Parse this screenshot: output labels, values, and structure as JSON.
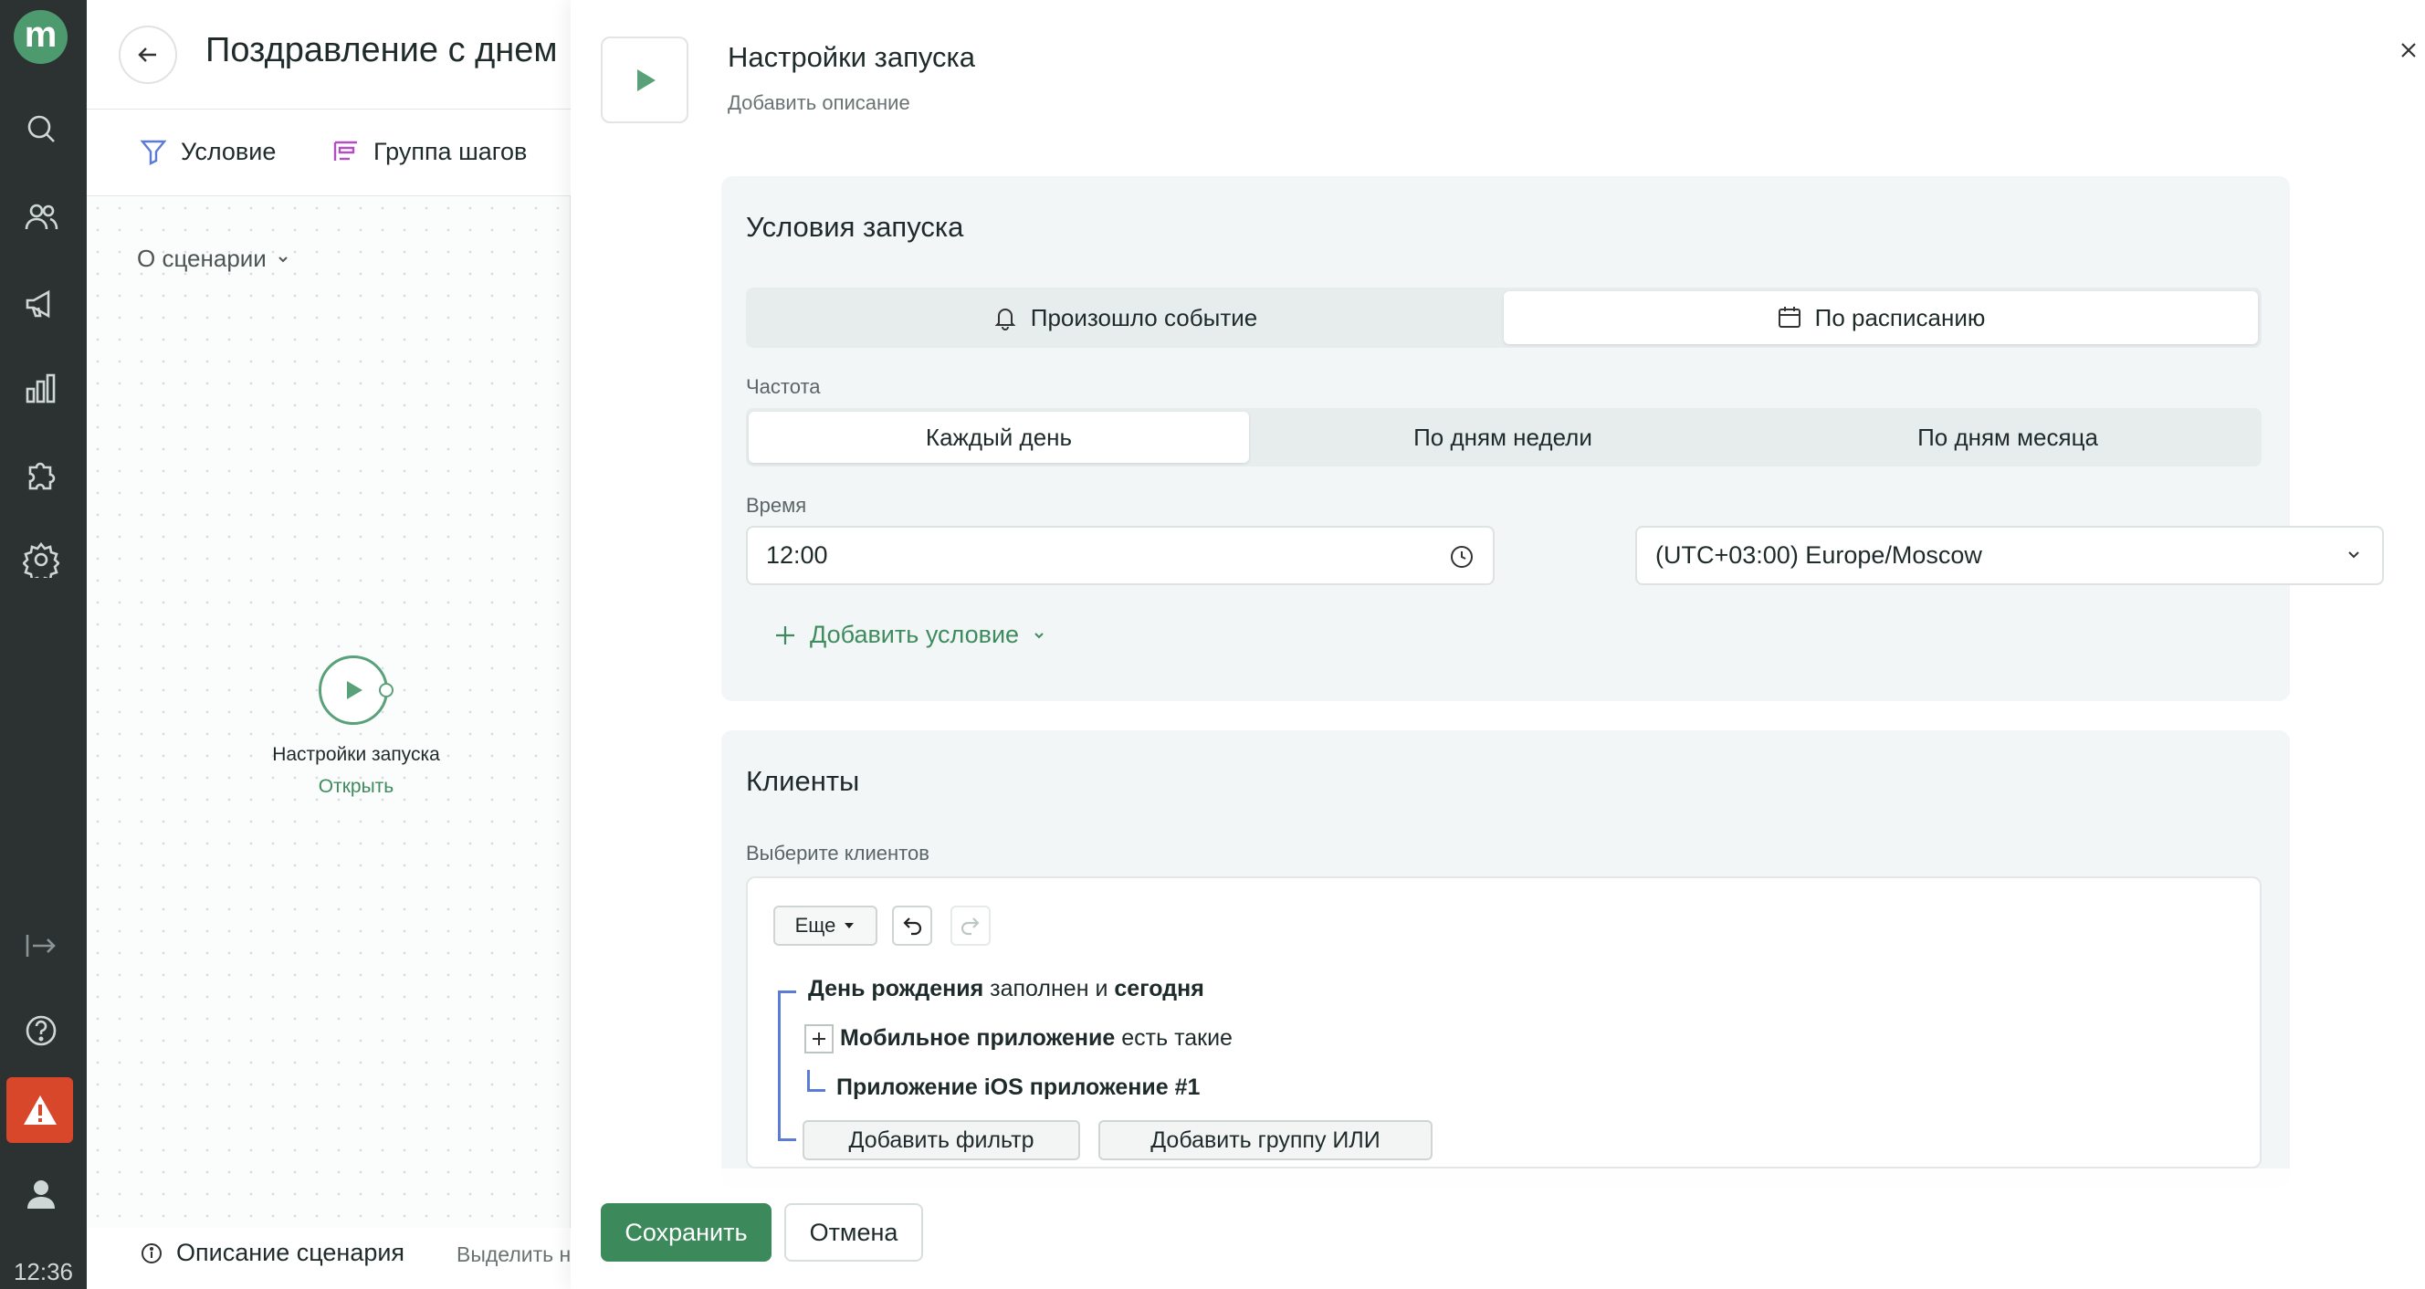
{
  "nav": {
    "logo": "m",
    "time": "12:36"
  },
  "canvas": {
    "title": "Поздравление с днем",
    "toolbar": {
      "condition": "Условие",
      "step_group": "Группа шагов"
    },
    "about": "О сценарии",
    "start_node": {
      "label": "Настройки запуска",
      "open": "Открыть"
    },
    "footer": {
      "description": "Описание сценария",
      "select": "Выделить н"
    }
  },
  "panel": {
    "title": "Настройки запуска",
    "description": "Добавить описание",
    "launch": {
      "title": "Условия запуска",
      "trigger_tabs": [
        "Произошло событие",
        "По расписанию"
      ],
      "frequency_label": "Частота",
      "frequency_tabs": [
        "Каждый день",
        "По дням недели",
        "По дням месяца"
      ],
      "time_label": "Время",
      "time_value": "12:00",
      "timezone": "(UTC+03:00) Europe/Moscow",
      "add_condition": "Добавить условие"
    },
    "clients": {
      "title": "Клиенты",
      "select_label": "Выберите клиентов",
      "more_button": "Еще",
      "filter1_field": "День рождения",
      "filter1_op": "заполнен и",
      "filter1_value": "сегодня",
      "filter2_field": "Мобильное приложение",
      "filter2_op": "есть такие",
      "filter3": "Приложение iOS приложение #1",
      "add_filter": "Добавить фильтр",
      "add_or_group": "Добавить группу ИЛИ"
    },
    "footer": {
      "save": "Сохранить",
      "cancel": "Отмена"
    }
  }
}
